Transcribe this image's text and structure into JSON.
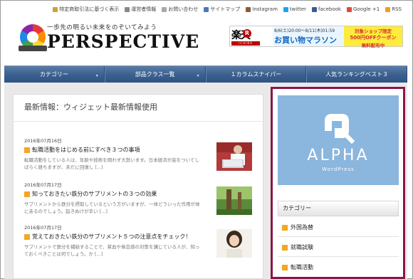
{
  "top_links": [
    {
      "label": "特定商取引法に基づく表示",
      "icon": "document-icon",
      "color": "#c9a23a"
    },
    {
      "label": "運営者情報",
      "icon": "person-icon",
      "color": "#888888"
    },
    {
      "label": "お問い合わせ",
      "icon": "mail-icon",
      "color": "#aaaaaa"
    },
    {
      "label": "サイトマップ",
      "icon": "sitemap-icon",
      "color": "#4a7ab8"
    },
    {
      "label": "Instagram",
      "icon": "instagram-icon",
      "color": "#8a5a3c"
    },
    {
      "label": "twitter",
      "icon": "twitter-icon",
      "color": "#1da1f2"
    },
    {
      "label": "facebook",
      "icon": "facebook-icon",
      "color": "#3b5998"
    },
    {
      "label": "Google +1",
      "icon": "google-plus-icon",
      "color": "#dd4b39"
    },
    {
      "label": "RSS",
      "icon": "rss-icon",
      "color": "#f59a23"
    }
  ],
  "header": {
    "tagline": "一歩先の明るい未来をのぞいてみよう",
    "site_title": "PERSPECTIVE"
  },
  "banner": {
    "brand": "楽天",
    "brand_r": "R",
    "brand_sub": "ICHIBA",
    "dates": "8/6(土)20:00～8/11(木)01:59",
    "campaign": "お買い物マラソン",
    "promo_line1": "対象ショップ限定",
    "promo_line2": "500円OFFクーポン",
    "promo_line3": "無料配布中"
  },
  "nav": {
    "items": [
      {
        "label": "カテゴリー",
        "has_dropdown": true
      },
      {
        "label": "部品クラス一覧",
        "has_dropdown": true
      },
      {
        "label": "１カラムスナイパー",
        "has_dropdown": false
      },
      {
        "label": "人気ランキングベスト３",
        "has_dropdown": false
      }
    ],
    "dropdown_glyph": "▾"
  },
  "main": {
    "title": "最新情報：ウィジェット最新情報使用",
    "posts": [
      {
        "date": "2016年07月16日",
        "title": "転職活動をはじめる前にすべき３つの事項",
        "excerpt": "転職活動をしている人は、年齢や技術を問わず大勢います。日本経済が底をついてしばらく経ちますが、未だに回復し [...]"
      },
      {
        "date": "2016年07月17日",
        "title": "知っておきたい鉄分のサプリメントの３つの効果",
        "excerpt": "サプリメントから鉄分を摂取しているという方がいますが、一体どういった作用が体にあるのでしょう。起きぬけが辛い [...]"
      },
      {
        "date": "2016年07月17日",
        "title": "覚えておきたい鉄分のサプリメント５つの注意点をチェック！",
        "excerpt": "サプリメントで鉄分を補給することで、貧血や倦怠感の対策を講じている人が、知っておくべきことは何でしょう。か [...]"
      }
    ]
  },
  "sidebar": {
    "ad_word": "ALPHA",
    "ad_sub": "WordPress",
    "ad_bg": "#8bb6dd",
    "category_heading": "カテゴリー",
    "categories": [
      "外国為替",
      "就職試験",
      "転職活動"
    ],
    "frame_color": "#8b1547"
  }
}
